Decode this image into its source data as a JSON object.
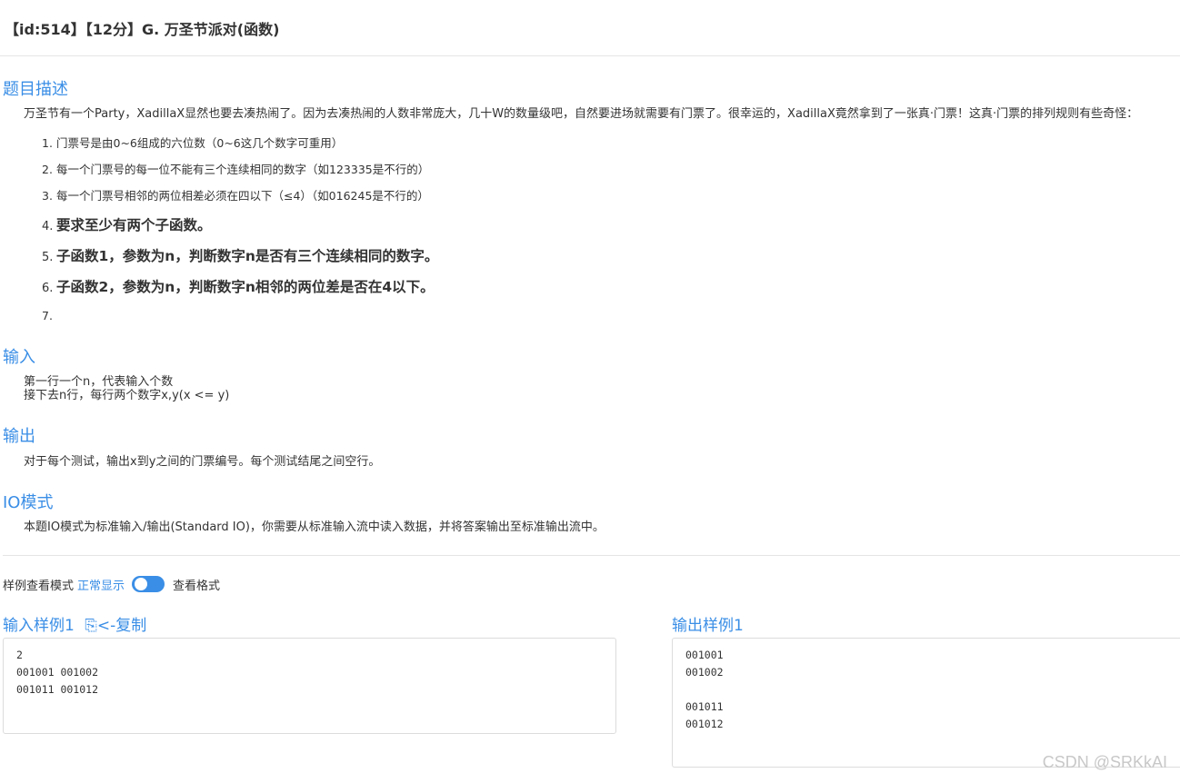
{
  "header": {
    "title": "【id:514】【12分】G. 万圣节派对(函数)"
  },
  "description": {
    "heading": "题目描述",
    "intro": "万圣节有一个Party，XadillaX显然也要去凑热闹了。因为去凑热闹的人数非常庞大，几十W的数量级吧，自然要进场就需要有门票了。很幸运的，XadillaX竟然拿到了一张真·门票！这真·门票的排列规则有些奇怪：",
    "rules": [
      {
        "num": "1.",
        "text": "门票号是由0~6组成的六位数（0~6这几个数字可重用）"
      },
      {
        "num": "2.",
        "text": "每一个门票号的每一位不能有三个连续相同的数字（如123335是不行的）"
      },
      {
        "num": "3.",
        "text": "每一个门票号相邻的两位相差必须在四以下（≤4）（如016245是不行的）"
      },
      {
        "num": "4.",
        "text": "要求至少有两个子函数。"
      },
      {
        "num": "5.",
        "text": "子函数1，参数为n，判断数字n是否有三个连续相同的数字。"
      },
      {
        "num": "6.",
        "text": "子函数2，参数为n，判断数字n相邻的两位差是否在4以下。"
      },
      {
        "num": "7.",
        "text": ""
      }
    ]
  },
  "input": {
    "heading": "输入",
    "line1": "第一行一个n，代表输入个数",
    "line2": "接下去n行，每行两个数字x,y(x <= y)"
  },
  "output": {
    "heading": "输出",
    "text": "对于每个测试，输出x到y之间的门票编号。每个测试结尾之间空行。"
  },
  "io_mode": {
    "heading": "IO模式",
    "text": "本题IO模式为标准输入/输出(Standard IO)，你需要从标准输入流中读入数据，并将答案输出至标准输出流中。"
  },
  "sample_mode": {
    "label": "样例查看模式",
    "normal": "正常显示",
    "format": "查看格式",
    "toggle_on": true
  },
  "samples": {
    "input_heading": "输入样例1",
    "copy_label": "<-复制",
    "input_text": "2\n001001 001002\n001011 001012",
    "output_heading": "输出样例1",
    "output_text": "001001\n001002\n\n001011\n001012"
  },
  "watermark": "CSDN @SRKkAI",
  "colors": {
    "accent": "#3a8ee6",
    "text": "#333333",
    "border": "#dcdcdc"
  }
}
